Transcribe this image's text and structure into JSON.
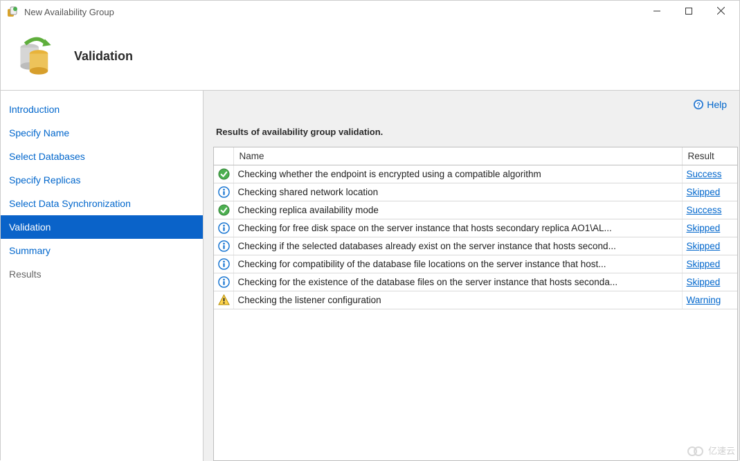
{
  "window": {
    "title": "New Availability Group"
  },
  "header": {
    "page_title": "Validation"
  },
  "sidebar": {
    "items": [
      {
        "label": "Introduction",
        "state": "completed"
      },
      {
        "label": "Specify Name",
        "state": "completed"
      },
      {
        "label": "Select Databases",
        "state": "completed"
      },
      {
        "label": "Specify Replicas",
        "state": "completed"
      },
      {
        "label": "Select Data Synchronization",
        "state": "completed"
      },
      {
        "label": "Validation",
        "state": "selected"
      },
      {
        "label": "Summary",
        "state": "upcoming-done"
      },
      {
        "label": "Results",
        "state": "pending"
      }
    ]
  },
  "content": {
    "help_label": "Help",
    "results_title": "Results of availability group validation.",
    "columns": {
      "name": "Name",
      "result": "Result"
    },
    "rows": [
      {
        "icon": "success",
        "name": "Checking whether the endpoint is encrypted using a compatible algorithm",
        "result": "Success"
      },
      {
        "icon": "info",
        "name": "Checking shared network location",
        "result": "Skipped"
      },
      {
        "icon": "success",
        "name": "Checking replica availability mode",
        "result": "Success"
      },
      {
        "icon": "info",
        "name": "Checking for free disk space on the server instance that hosts secondary replica AO1\\AL...",
        "result": "Skipped"
      },
      {
        "icon": "info",
        "name": "Checking if the selected databases already exist on the server instance that hosts second...",
        "result": "Skipped"
      },
      {
        "icon": "info",
        "name": "Checking for compatibility of the database file locations on the server instance that host...",
        "result": "Skipped"
      },
      {
        "icon": "info",
        "name": "Checking for the existence of the database files on the server instance that hosts seconda...",
        "result": "Skipped"
      },
      {
        "icon": "warning",
        "name": "Checking the listener configuration",
        "result": "Warning"
      }
    ]
  },
  "watermark": {
    "text": "亿速云"
  }
}
